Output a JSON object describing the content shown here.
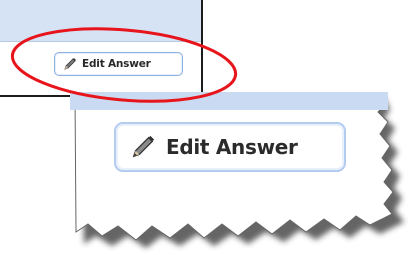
{
  "original_panel": {
    "button_label": "Edit Answer",
    "button_icon": "pencil-icon"
  },
  "zoom_callout": {
    "button_label": "Edit Answer",
    "button_icon": "pencil-icon"
  },
  "colors": {
    "highlight": "#e8141b",
    "panel_band": "#d6e3f5",
    "button_border": "#8fb1de",
    "frame": "#1c1c1c"
  }
}
